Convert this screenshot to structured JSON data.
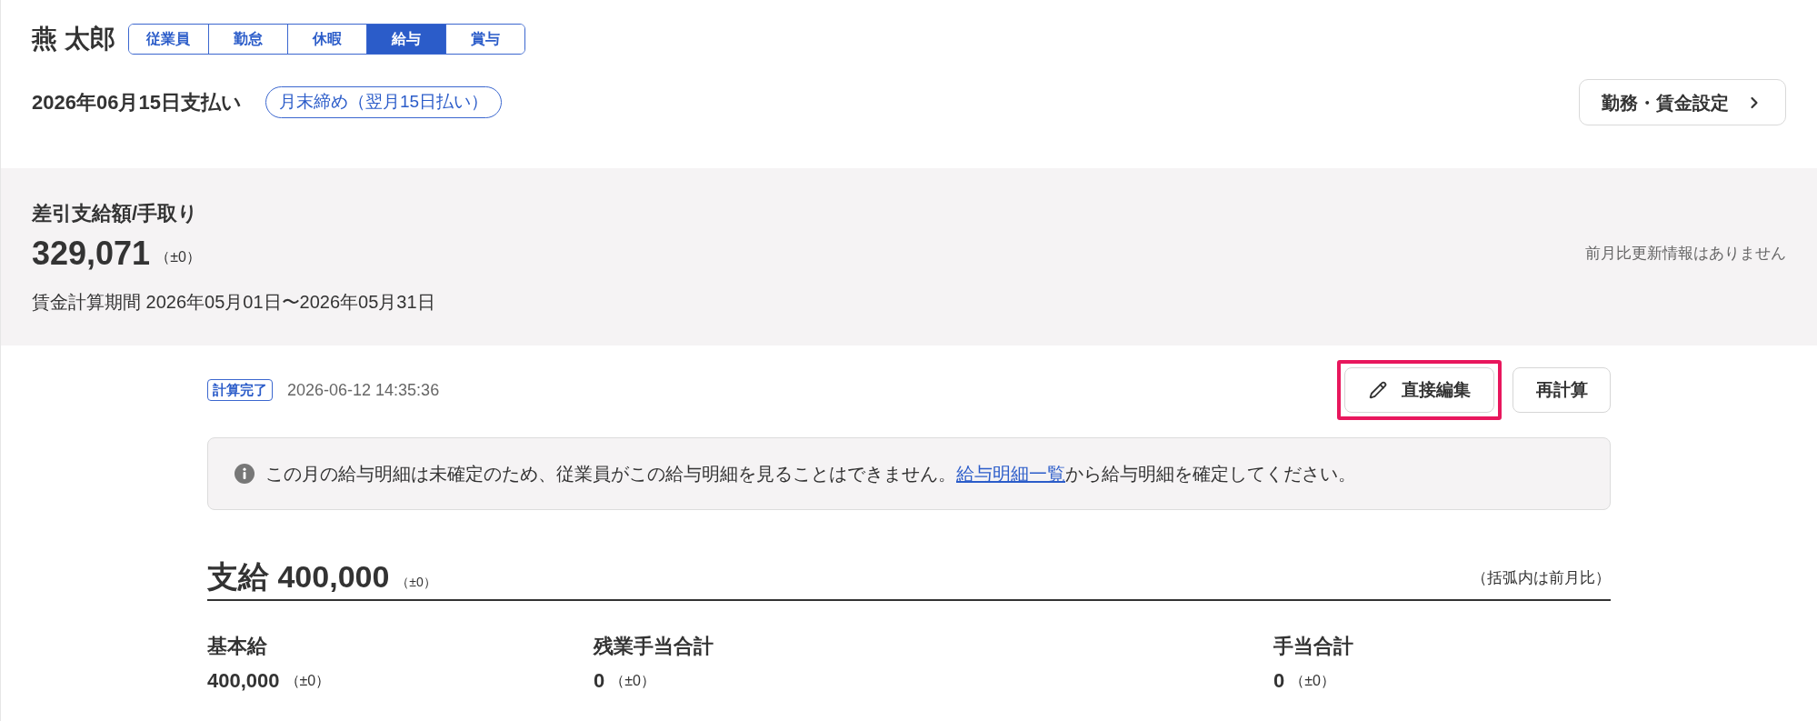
{
  "employee": {
    "name": "燕 太郎"
  },
  "tabs": [
    {
      "label": "従業員",
      "selected": false
    },
    {
      "label": "勤怠",
      "selected": false
    },
    {
      "label": "休暇",
      "selected": false
    },
    {
      "label": "給与",
      "selected": true
    },
    {
      "label": "賞与",
      "selected": false
    }
  ],
  "payment": {
    "date": "2026年06月15日支払い",
    "cycle_badge": "月末締め（翌月15日払い）"
  },
  "settings_button": {
    "label": "勤務・賃金設定"
  },
  "summary": {
    "title": "差引支給額/手取り",
    "amount": "329,071",
    "diff": "（±0）",
    "comparison_note": "前月比更新情報はありません",
    "period": "賃金計算期間 2026年05月01日〜2026年05月31日"
  },
  "calculation": {
    "status": "計算完了",
    "timestamp": "2026-06-12 14:35:36"
  },
  "actions": [
    {
      "label": "直接編集",
      "kind": "edit",
      "highlighted": true
    },
    {
      "label": "再計算",
      "kind": "plain",
      "highlighted": false
    }
  ],
  "notice": {
    "text_before": "この月の給与明細は未確定のため、従業員がこの給与明細を見ることはできません。",
    "link": "給与明細一覧",
    "text_after": "から給与明細を確定してください。"
  },
  "earnings": {
    "title": "支給",
    "total": "400,000",
    "diff": "（±0）",
    "note": "（括弧内は前月比）",
    "items": [
      {
        "label": "基本給",
        "value": "400,000",
        "diff": "（±0）"
      },
      {
        "label": "残業手当合計",
        "value": "0",
        "diff": "（±0）"
      },
      {
        "label": "手当合計",
        "value": "0",
        "diff": "（±0）"
      }
    ]
  }
}
